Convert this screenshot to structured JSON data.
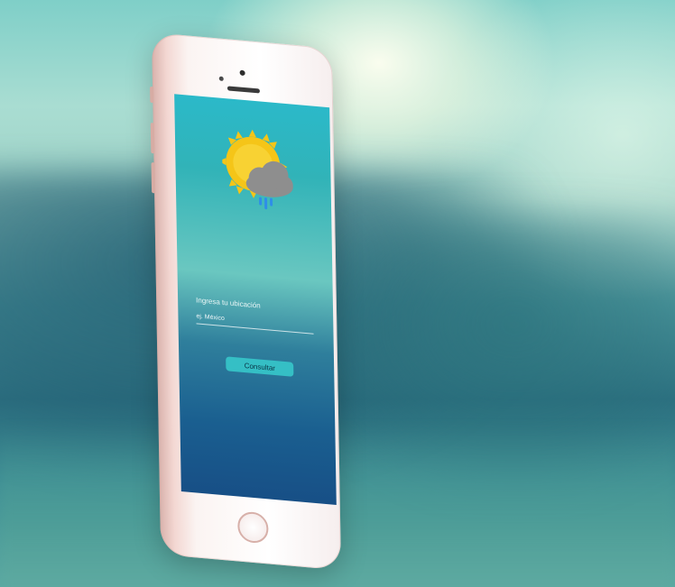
{
  "app": {
    "icon": "sun-cloud-rain-icon",
    "colors": {
      "sun": "#f5c518",
      "cloud": "#8e8e8e",
      "rain": "#2f8ee8",
      "button": "#35bfc5"
    }
  },
  "location": {
    "label": "Ingresa tu ubicación",
    "placeholder": "ej. México",
    "value": ""
  },
  "actions": {
    "submit_label": "Consultar"
  }
}
